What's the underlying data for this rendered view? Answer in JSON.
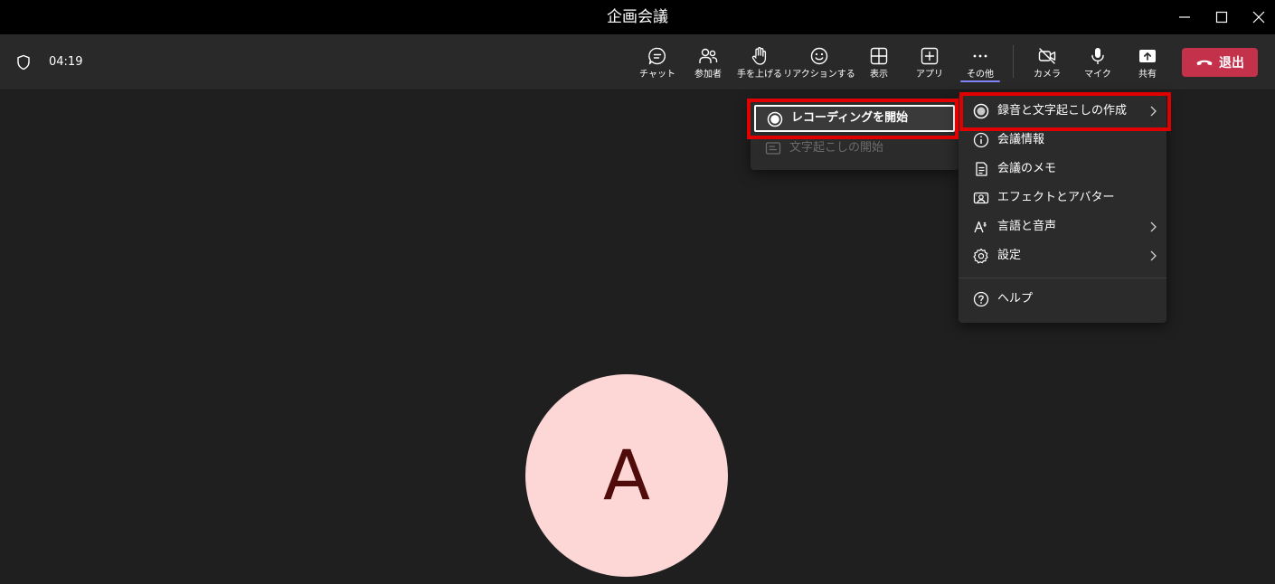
{
  "window": {
    "title": "企画会議",
    "controls": [
      "minimize-icon",
      "maximize-icon",
      "close-icon"
    ]
  },
  "meeting": {
    "timer": "04:19"
  },
  "toolbar": {
    "chat": "チャット",
    "participants": "参加者",
    "raise_hand": "手を上げる",
    "reactions": "リアクションする",
    "view": "表示",
    "apps": "アプリ",
    "more": "その他",
    "camera": "カメラ",
    "mic": "マイク",
    "share": "共有",
    "leave": "退出"
  },
  "more_menu": {
    "items": [
      {
        "label": "録音と文字起こしの作成",
        "icon": "record-icon",
        "has_submenu": true
      },
      {
        "label": "会議情報",
        "icon": "info-icon",
        "has_submenu": false
      },
      {
        "label": "会議のメモ",
        "icon": "notes-icon",
        "has_submenu": false
      },
      {
        "label": "エフェクトとアバター",
        "icon": "effects-icon",
        "has_submenu": false
      },
      {
        "label": "言語と音声",
        "icon": "language-icon",
        "has_submenu": true
      },
      {
        "label": "設定",
        "icon": "gear-icon",
        "has_submenu": true
      },
      {
        "label": "ヘルプ",
        "icon": "help-icon",
        "has_submenu": false
      }
    ]
  },
  "recording_submenu": {
    "items": [
      {
        "label": "レコーディングを開始",
        "icon": "record-icon",
        "enabled": true
      },
      {
        "label": "文字起こしの開始",
        "icon": "transcript-icon",
        "enabled": false
      }
    ]
  },
  "participant": {
    "initial": "A"
  },
  "colors": {
    "titlebar": "#000000",
    "toolbar": "#292929",
    "stage": "#1f1f1f",
    "menu": "#2b2b2b",
    "leave": "#c4314b",
    "accent": "#7f85f5",
    "highlight": "#e00000",
    "avatar_bg": "#fdd6d6",
    "avatar_text": "#500b0b"
  }
}
